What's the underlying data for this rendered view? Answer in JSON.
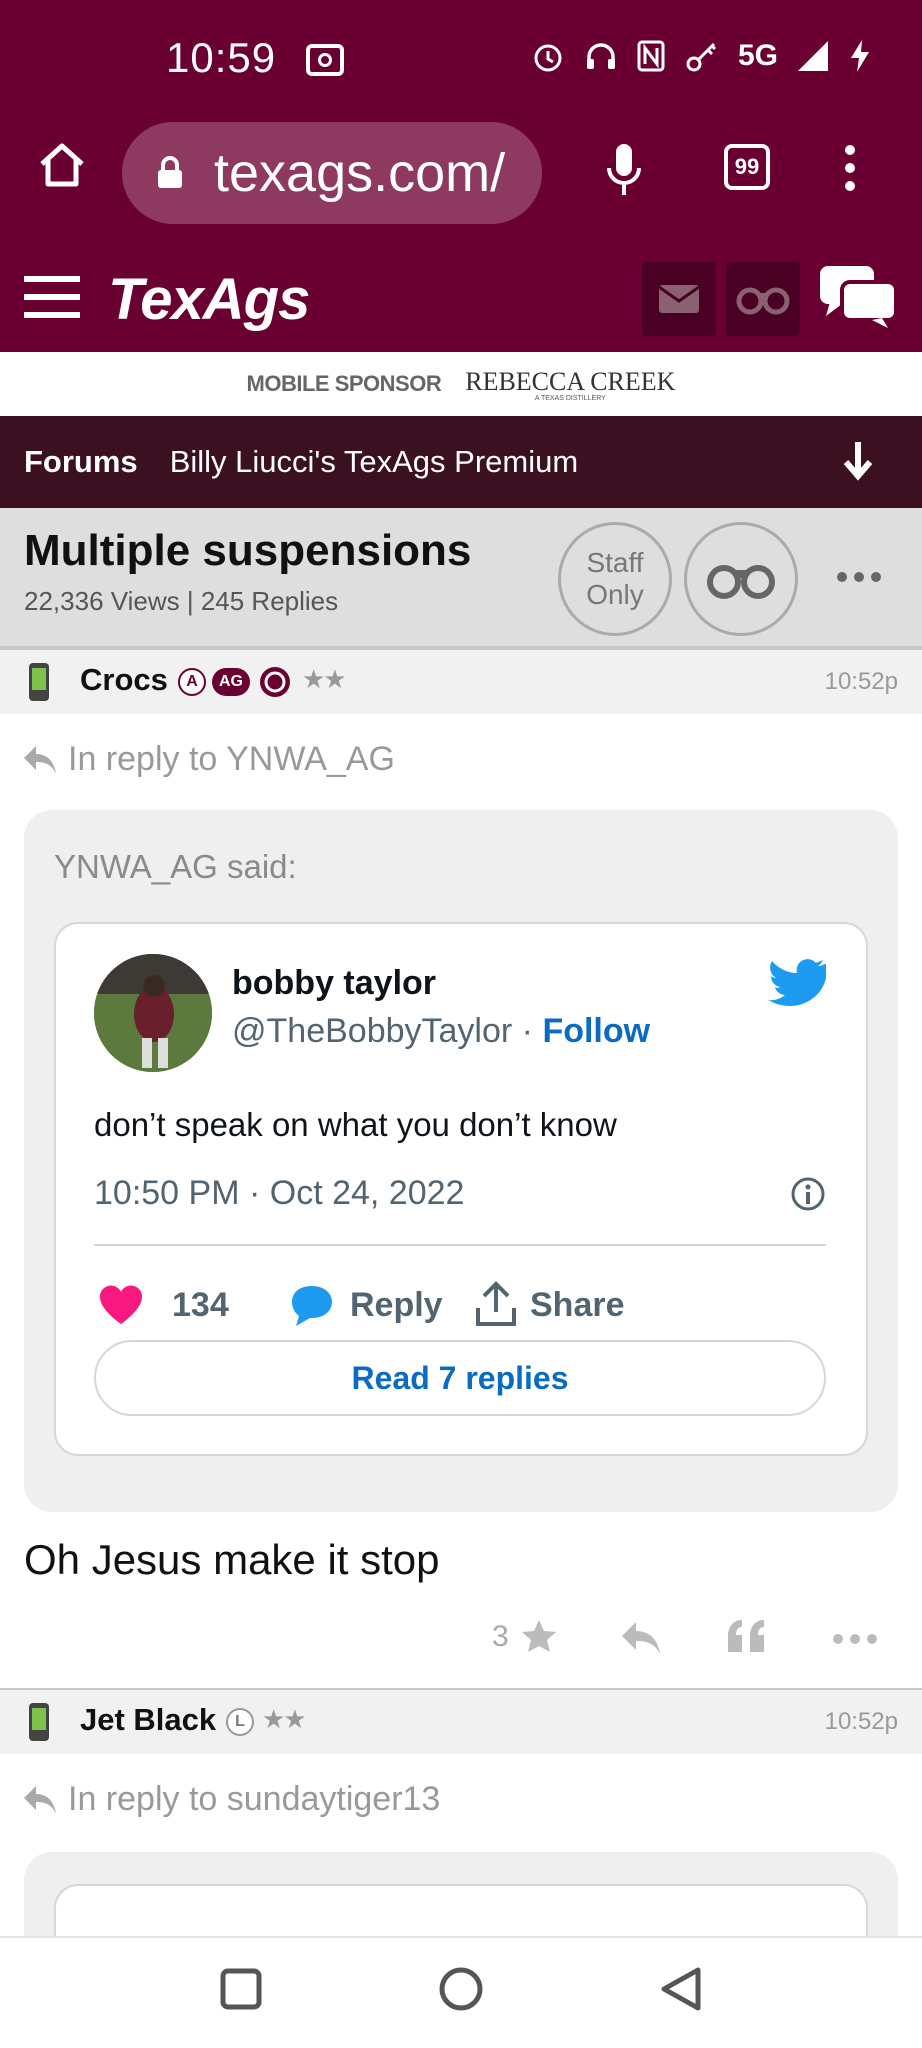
{
  "status": {
    "time": "10:59",
    "network": "5G"
  },
  "browser": {
    "url": "texags.com/",
    "tab_count": "99"
  },
  "site": {
    "brand": "TexAgs"
  },
  "sponsor": {
    "label": "MOBILE SPONSOR",
    "name": "REBECCA CREEK",
    "tagline": "A TEXAS DISTILLERY"
  },
  "forum": {
    "section": "Forums",
    "board": "Billy Liucci's TexAgs Premium"
  },
  "thread": {
    "title": "Multiple suspensions",
    "meta": "22,336 Views | 245 Replies",
    "staff_only": [
      "Staff",
      "Only"
    ]
  },
  "posts": [
    {
      "author": "Crocs",
      "badges": [
        "A",
        "AG"
      ],
      "stars": "★★",
      "time": "10:52p",
      "reply_to": "In reply to YNWA_AG",
      "quote_said": "YNWA_AG said:",
      "tweet": {
        "name": "bobby taylor",
        "handle": "@TheBobbyTaylor",
        "separator": "·",
        "follow": "Follow",
        "text": "don’t speak on what you don’t know",
        "date": "10:50 PM · Oct 24, 2022",
        "likes": "134",
        "reply": "Reply",
        "share": "Share",
        "read_replies": "Read 7 replies"
      },
      "body": "Oh Jesus make it stop",
      "star_count": "3"
    },
    {
      "author": "Jet Black",
      "badges": [
        "L"
      ],
      "stars": "★★",
      "time": "10:52p",
      "reply_to": "In reply to sundaytiger13"
    }
  ],
  "colors": {
    "maroon": "#6a0032",
    "dark_bar": "#3b1020",
    "twitter_blue": "#1d9bf0",
    "like_pink": "#f91880"
  }
}
